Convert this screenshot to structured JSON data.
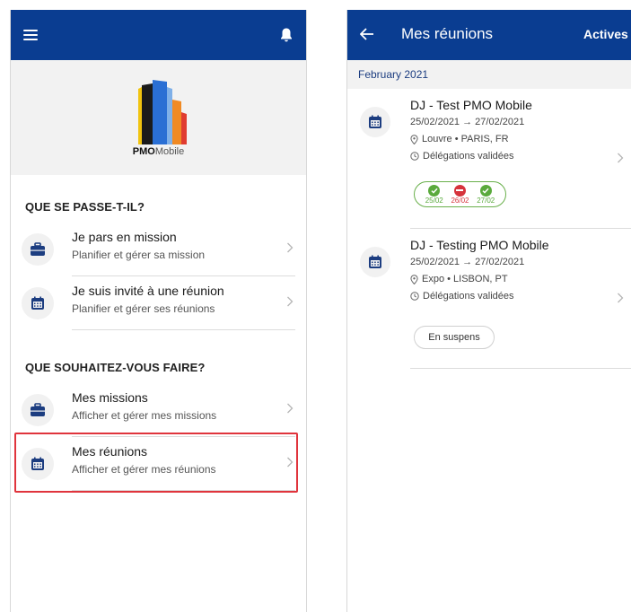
{
  "left_screen": {
    "logo": {
      "brand_bold": "PMO",
      "brand_light": "Mobile"
    },
    "sections": [
      {
        "title": "QUE SE PASSE-T-IL?",
        "items": [
          {
            "title": "Je pars en mission",
            "subtitle": "Planifier et gérer sa mission",
            "icon": "briefcase-icon"
          },
          {
            "title": "Je suis invité à une réunion",
            "subtitle": "Planifier et gérer ses réunions",
            "icon": "calendar-icon"
          }
        ]
      },
      {
        "title": "QUE SOUHAITEZ-VOUS FAIRE?",
        "items": [
          {
            "title": "Mes missions",
            "subtitle": "Afficher et gérer mes missions",
            "icon": "briefcase-icon"
          },
          {
            "title": "Mes réunions",
            "subtitle": "Afficher et gérer mes réunions",
            "icon": "calendar-icon"
          }
        ]
      }
    ]
  },
  "right_screen": {
    "title": "Mes réunions",
    "filter_label": "Actives",
    "month": "February 2021",
    "meetings": [
      {
        "title": "DJ - Test PMO Mobile",
        "dates": "25/02/2021 → 27/02/2021",
        "location": "Louvre • PARIS, FR",
        "status": "Délégations validées",
        "days": [
          {
            "label": "25/02",
            "state": "ok"
          },
          {
            "label": "26/02",
            "state": "refused"
          },
          {
            "label": "27/02",
            "state": "ok"
          }
        ]
      },
      {
        "title": "DJ - Testing PMO Mobile",
        "dates": "25/02/2021 → 27/02/2021",
        "location": "Expo • LISBON, PT",
        "status": "Délégations validées",
        "badge": "En suspens"
      }
    ]
  },
  "colors": {
    "appbar": "#0a3d91",
    "ok": "#5aaa3c",
    "refused": "#d6333c",
    "highlight": "#e0343c",
    "icon": "#1c3d80"
  }
}
